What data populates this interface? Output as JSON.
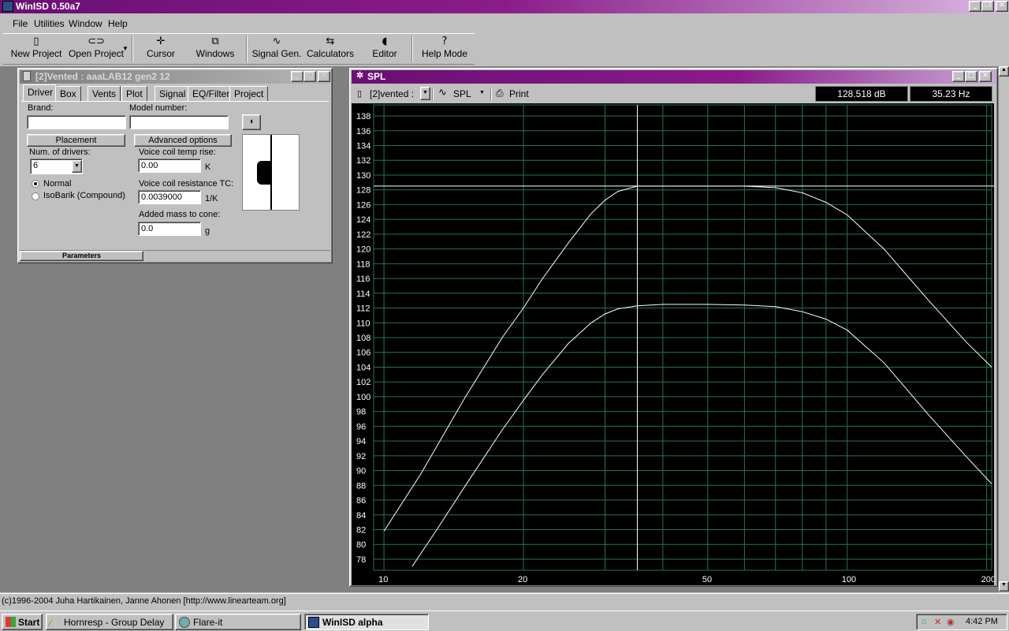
{
  "app": {
    "title": "WinISD 0.50a7"
  },
  "menu": [
    "File",
    "Utilities",
    "Window",
    "Help"
  ],
  "toolbar": {
    "new_project": "New Project",
    "open_project": "Open Project",
    "cursor": "Cursor",
    "windows": "Windows",
    "signal_gen": "Signal Gen.",
    "calculators": "Calculators",
    "editor": "Editor",
    "help_mode": "Help Mode"
  },
  "driver_window": {
    "title": "[2]Vented : aaaLAB12 gen2 12",
    "tabs": [
      "Driver",
      "Box",
      "Vents",
      "Plot",
      "Signal",
      "EQ/Filter",
      "Project"
    ],
    "active_tab": "Driver",
    "brand_label": "Brand:",
    "brand_value": "",
    "model_label": "Model number:",
    "model_value": "",
    "placement_button": "Placement",
    "advanced_button": "Advanced options",
    "num_drivers_label": "Num. of drivers:",
    "num_drivers_value": "6",
    "radio_normal": "Normal",
    "radio_isobarik": "IsoBarik (Compound)",
    "vc_temp_label": "Voice coil temp rise:",
    "vc_temp_value": "0.00",
    "vc_temp_unit": "K",
    "vc_tc_label": "Voice coil resistance TC:",
    "vc_tc_value": "0.0039000",
    "vc_tc_unit": "1/K",
    "added_mass_label": "Added mass to cone:",
    "added_mass_value": "0.0",
    "added_mass_unit": "g",
    "bottom_tab": "Parameters"
  },
  "spl_window": {
    "title": "SPL",
    "project_select": "[2]vented :",
    "plot_select": "SPL",
    "print_button": "Print",
    "readout_db": "128.518 dB",
    "readout_hz": "35.23 Hz"
  },
  "chart_data": {
    "type": "line",
    "xscale": "log",
    "xlim": [
      9.5,
      205
    ],
    "ylim": [
      76.5,
      139.5
    ],
    "x_tick_labels": [
      "10",
      "20",
      "50",
      "100",
      "200"
    ],
    "y_ticks": [
      78,
      80,
      82,
      84,
      86,
      88,
      90,
      92,
      94,
      96,
      98,
      100,
      102,
      104,
      106,
      108,
      110,
      112,
      114,
      116,
      118,
      120,
      122,
      124,
      126,
      128,
      130,
      132,
      134,
      136,
      138
    ],
    "grid": true,
    "cursor_hz": 35.23,
    "cursor_db": 128.518,
    "series": [
      {
        "x": [
          10,
          12,
          15,
          18,
          20,
          22,
          25,
          28,
          30,
          32,
          35.23,
          40,
          50,
          60,
          70,
          80,
          90,
          100,
          120,
          150,
          180,
          205
        ],
        "y": [
          81.8,
          89.5,
          100,
          108,
          112,
          116,
          120.8,
          124.8,
          126.6,
          127.8,
          128.5,
          128.5,
          128.5,
          128.5,
          128.3,
          127.6,
          126.3,
          124.6,
          120,
          113,
          107.5,
          104
        ]
      },
      {
        "x": [
          11.5,
          13,
          15,
          18,
          20,
          22,
          25,
          28,
          30,
          32,
          35.23,
          40,
          50,
          60,
          70,
          80,
          90,
          100,
          120,
          150,
          180,
          205
        ],
        "y": [
          77,
          82,
          88,
          95.5,
          99.5,
          103,
          107.2,
          110,
          111.2,
          111.9,
          112.3,
          112.5,
          112.5,
          112.4,
          112.2,
          111.5,
          110.5,
          109,
          104.6,
          97.5,
          92,
          88.2
        ]
      }
    ]
  },
  "status": "(c)1996-2004 Juha Hartikainen, Janne Ahonen [http://www.linearteam.org]",
  "taskbar": {
    "start": "Start",
    "items": [
      "Hornresp - Group Delay",
      "Flare-it",
      "WinISD alpha"
    ],
    "clock": "4:42 PM"
  },
  "colors": {
    "title_active": "#6a0f74",
    "plot_bg": "#000000",
    "grid": "#1e7a4e",
    "curve": "#ffffff"
  }
}
